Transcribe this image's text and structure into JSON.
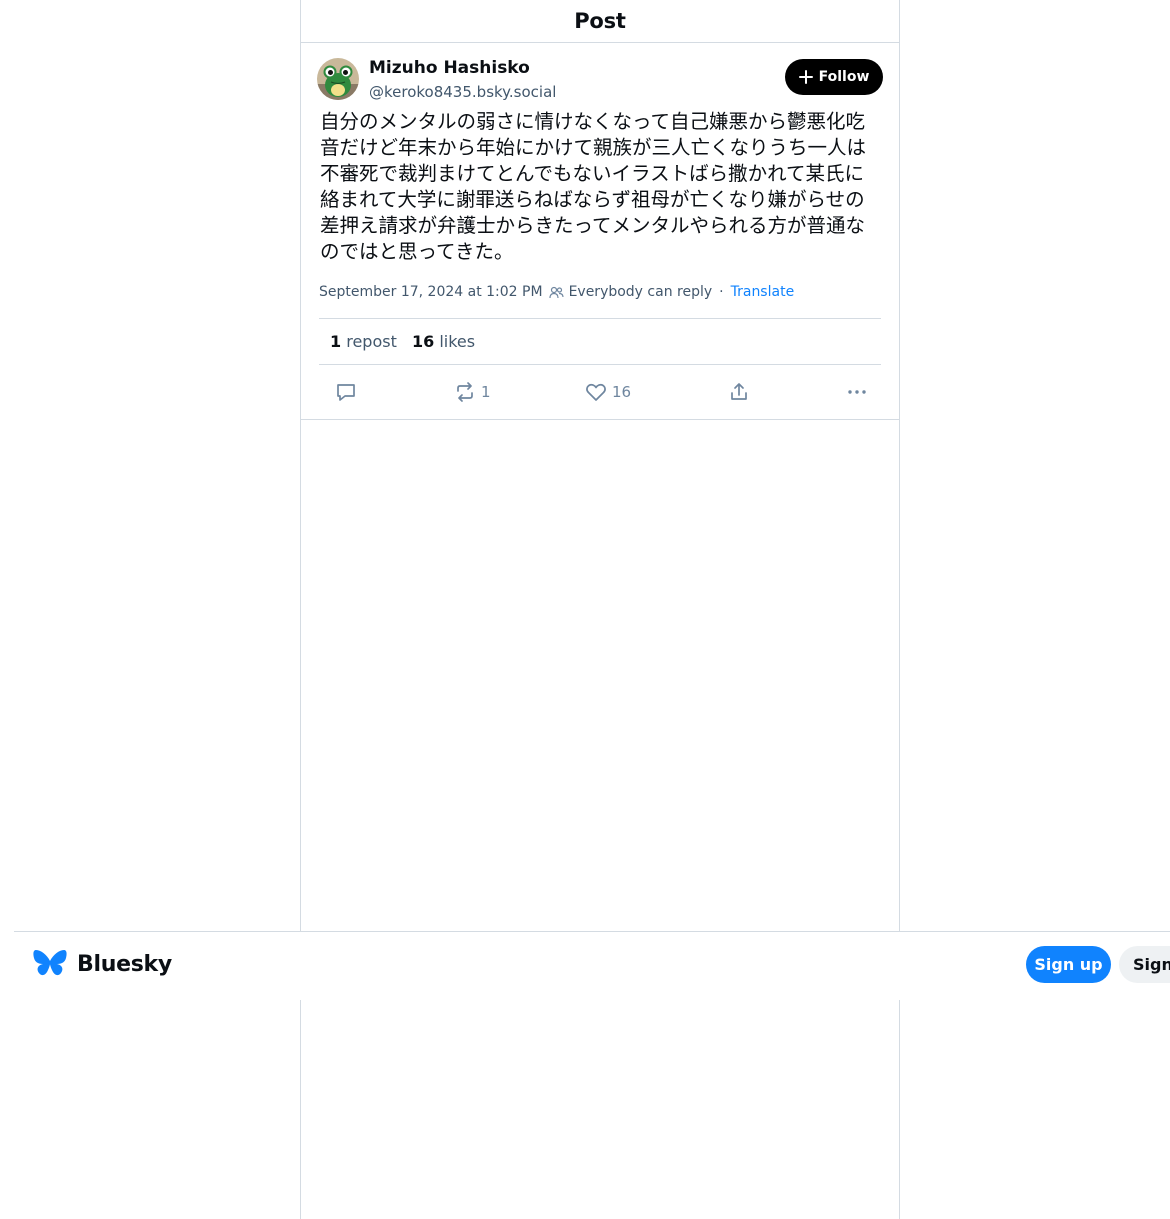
{
  "header": {
    "title": "Post"
  },
  "author": {
    "name": "Mizuho Hashisko",
    "handle": "@keroko8435.bsky.social",
    "follow_label": "Follow"
  },
  "post": {
    "text": "自分のメンタルの弱さに情けなくなって自己嫌悪から鬱悪化吃音だけど年末から年始にかけて親族が三人亡くなりうち一人は不審死で裁判まけてとんでもないイラストばら撒かれて某氏に絡まれて大学に謝罪送らねばならず祖母が亡くなり嫌がらせの差押え請求が弁護士からきたってメンタルやられる方が普通なのではと思ってきた。",
    "timestamp": "September 17, 2024 at 1:02 PM",
    "reply_setting": "Everybody can reply",
    "separator": "·",
    "translate_label": "Translate"
  },
  "stats": {
    "reposts_count": "1",
    "reposts_label": "repost",
    "likes_count": "16",
    "likes_label": "likes"
  },
  "actions": {
    "repost_count": "1",
    "like_count": "16"
  },
  "footer": {
    "brand": "Bluesky",
    "signup_label": "Sign up",
    "signin_label": "Sign in",
    "brand_color": "#1083fe"
  },
  "icons": [
    "avatar",
    "plus-icon",
    "people-icon",
    "reply-icon",
    "repost-icon",
    "heart-icon",
    "share-icon",
    "more-icon",
    "butterfly-logo-icon"
  ]
}
